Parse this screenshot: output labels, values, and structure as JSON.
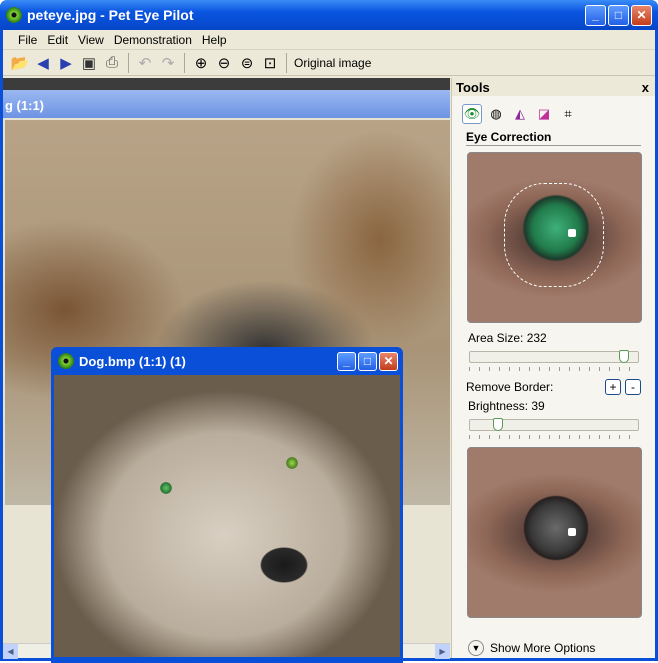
{
  "window": {
    "title": "peteye.jpg - Pet Eye Pilot"
  },
  "menu": [
    "File",
    "Edit",
    "View",
    "Demonstration",
    "Help"
  ],
  "toolbar": {
    "original_image": "Original image"
  },
  "background_doc": {
    "title": "g (1:1)"
  },
  "child_window": {
    "title": "Dog.bmp (1:1) (1)"
  },
  "tools_panel": {
    "title": "Tools",
    "close": "x",
    "section": "Eye Correction",
    "area_size_label": "Area Size: 232",
    "area_size_fraction": 0.91,
    "remove_border_label": "Remove Border:",
    "plus": "+",
    "minus": "-",
    "brightness_label": "Brightness: 39",
    "brightness_fraction": 0.17,
    "show_more": "Show More Options"
  }
}
